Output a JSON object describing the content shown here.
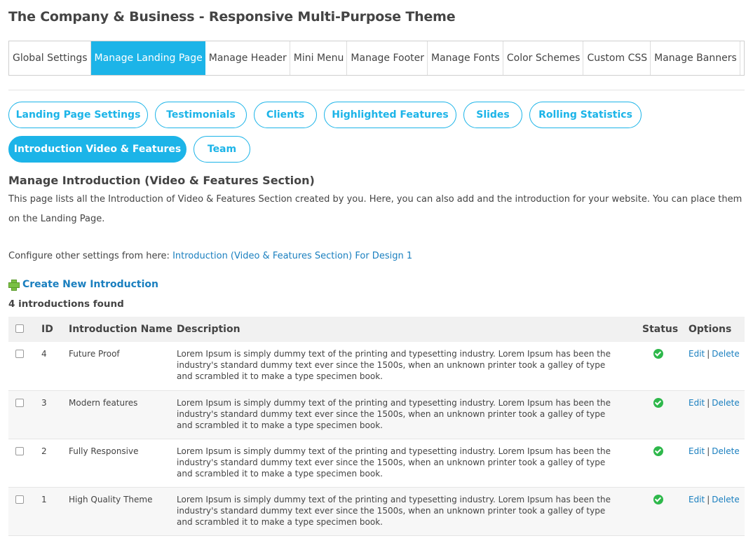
{
  "page_title": "The Company & Business - Responsive Multi-Purpose Theme",
  "tabs": [
    {
      "label": "Global Settings",
      "active": false
    },
    {
      "label": "Manage Landing Page",
      "active": true
    },
    {
      "label": "Manage Header",
      "active": false
    },
    {
      "label": "Mini Menu",
      "active": false
    },
    {
      "label": "Manage Footer",
      "active": false
    },
    {
      "label": "Manage Fonts",
      "active": false
    },
    {
      "label": "Color Schemes",
      "active": false
    },
    {
      "label": "Custom CSS",
      "active": false
    },
    {
      "label": "Manage Banners",
      "active": false
    }
  ],
  "subtabs": [
    {
      "label": "Landing Page Settings",
      "active": false
    },
    {
      "label": "Testimonials",
      "active": false
    },
    {
      "label": "Clients",
      "active": false
    },
    {
      "label": "Highlighted Features",
      "active": false
    },
    {
      "label": "Slides",
      "active": false
    },
    {
      "label": "Rolling Statistics",
      "active": false
    },
    {
      "label": "Introduction Video & Features",
      "active": true
    },
    {
      "label": "Team",
      "active": false
    }
  ],
  "section": {
    "title": "Manage Introduction (Video & Features Section)",
    "description": "This page lists all the Introduction of Video & Features Section created by you. Here, you can also add and the introduction for your website. You can place them on the Landing Page.",
    "config_prefix": "Configure other settings from here: ",
    "config_link": "Introduction (Video & Features Section) For Design 1",
    "create_label": "Create New Introduction",
    "found_text": "4 introductions found"
  },
  "table": {
    "headers": {
      "id": "ID",
      "name": "Introduction Name",
      "description": "Description",
      "status": "Status",
      "options": "Options"
    },
    "edit_label": "Edit",
    "separator": "|",
    "delete_label": "Delete",
    "rows": [
      {
        "id": "4",
        "name": "Future Proof",
        "description": "Lorem Ipsum is simply dummy text of the printing and typesetting industry. Lorem Ipsum has been the industry's standard dummy text ever since the 1500s, when an unknown printer took a galley of type and scrambled it to make a type specimen book.",
        "status": "active"
      },
      {
        "id": "3",
        "name": "Modern features",
        "description": "Lorem Ipsum is simply dummy text of the printing and typesetting industry. Lorem Ipsum has been the industry's standard dummy text ever since the 1500s, when an unknown printer took a galley of type and scrambled it to make a type specimen book.",
        "status": "active"
      },
      {
        "id": "2",
        "name": "Fully Responsive",
        "description": "Lorem Ipsum is simply dummy text of the printing and typesetting industry. Lorem Ipsum has been the industry's standard dummy text ever since the 1500s, when an unknown printer took a galley of type and scrambled it to make a type specimen book.",
        "status": "active"
      },
      {
        "id": "1",
        "name": "High Quality Theme",
        "description": "Lorem Ipsum is simply dummy text of the printing and typesetting industry. Lorem Ipsum has been the industry's standard dummy text ever since the 1500s, when an unknown printer took a galley of type and scrambled it to make a type specimen book.",
        "status": "active"
      }
    ]
  },
  "colors": {
    "accent": "#1cb4e8",
    "link": "#1a7fbf",
    "status_ok": "#2eb84b"
  }
}
